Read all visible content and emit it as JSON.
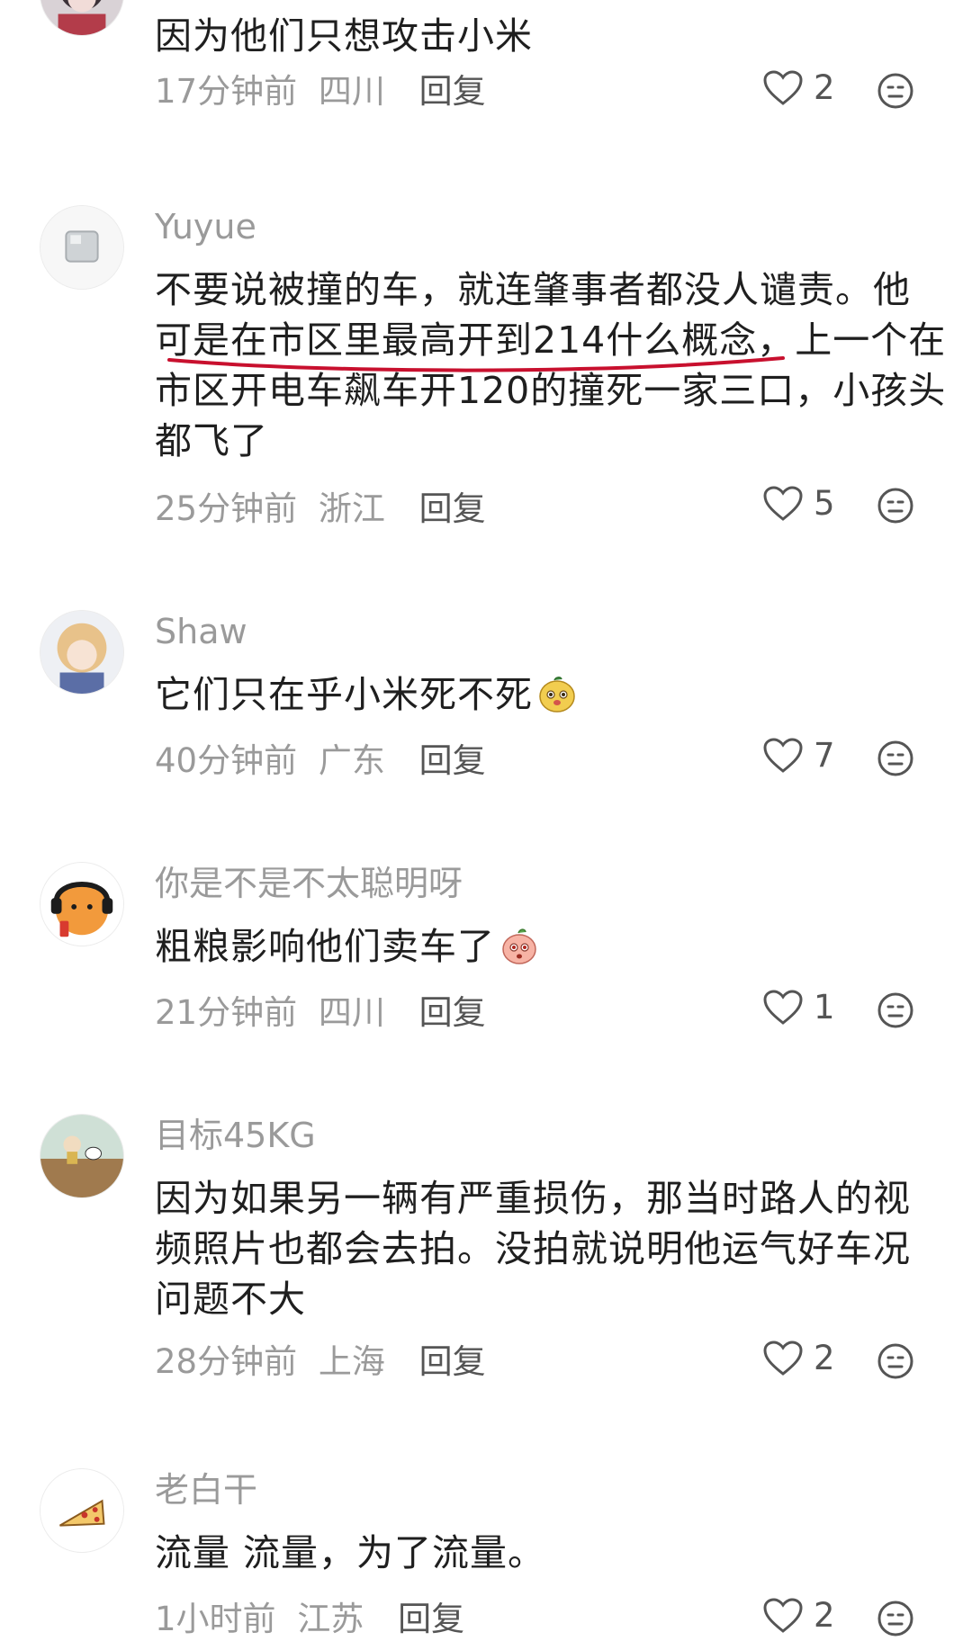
{
  "comments": [
    {
      "avatar": "anime-girl-avatar",
      "username": "",
      "lines": [
        "因为他们只想攻击小米"
      ],
      "time": "17分钟前",
      "location": "四川",
      "reply_label": "回复",
      "likes": "2"
    },
    {
      "avatar": "ice-cube-avatar",
      "username": "Yuyue",
      "lines": [
        "不要说被撞的车，就连肇事者都没人谴责。他",
        "可是在市区里最高开到214什么概念，上一个在",
        "市区开电车飙车开120的撞死一家三口，小孩头",
        "都飞了"
      ],
      "time": "25分钟前",
      "location": "浙江",
      "reply_label": "回复",
      "likes": "5",
      "highlight_color": "#c8102e"
    },
    {
      "avatar": "anime-character-avatar",
      "username": "Shaw",
      "lines": [
        "它们只在乎小米死不死"
      ],
      "emoji": "cute-face-emoji",
      "time": "40分钟前",
      "location": "广东",
      "reply_label": "回复",
      "likes": "7"
    },
    {
      "avatar": "orange-cat-headphones-avatar",
      "username": "你是不是不太聪明呀",
      "lines": [
        "粗粮影响他们卖车了"
      ],
      "emoji": "peach-face-emoji",
      "time": "21分钟前",
      "location": "四川",
      "reply_label": "回复",
      "likes": "1"
    },
    {
      "avatar": "snoopy-field-avatar",
      "username": "目标45KG",
      "lines": [
        "因为如果另一辆有严重损伤，那当时路人的视",
        "频照片也都会去拍。没拍就说明他运气好车况",
        "问题不大"
      ],
      "time": "28分钟前",
      "location": "上海",
      "reply_label": "回复",
      "likes": "2"
    },
    {
      "avatar": "pizza-slice-avatar",
      "username": "老白干",
      "lines": [
        "流量 流量，为了流量。"
      ],
      "time": "1小时前",
      "location": "江苏",
      "reply_label": "回复",
      "likes": "2"
    }
  ],
  "colors": {
    "meta_text": "#9a9a9a",
    "body_text": "#1f1f1f",
    "icon_stroke": "#555555",
    "highlight": "#c8102e"
  }
}
